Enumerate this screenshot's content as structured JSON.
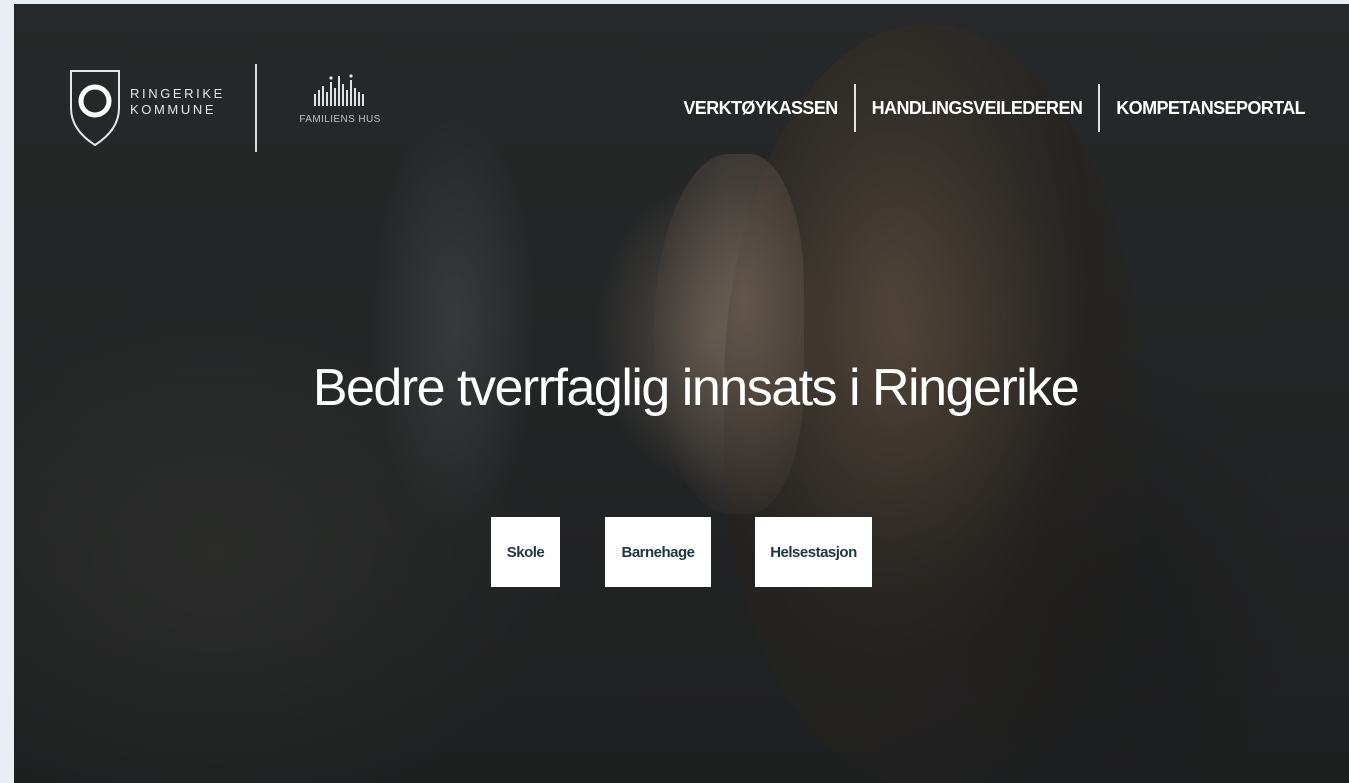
{
  "header": {
    "logo": {
      "line1": "RINGERIKE",
      "line2": "KOMMUNE"
    },
    "secondary_logo": {
      "text": "FAMILIENS HUS"
    },
    "nav": [
      {
        "label": "VERKTØYKASSEN"
      },
      {
        "label": "HANDLINGSVEILEDEREN"
      },
      {
        "label": "KOMPETANSEPORTAL"
      }
    ]
  },
  "hero": {
    "title": "Bedre tverrfaglig innsats i Ringerike",
    "buttons": [
      {
        "label": "Skole"
      },
      {
        "label": "Barnehage"
      },
      {
        "label": "Helsestasjon"
      }
    ]
  },
  "colors": {
    "button_bg": "#ffffff",
    "button_text": "#1f3542",
    "text_on_dark": "#ffffff"
  }
}
